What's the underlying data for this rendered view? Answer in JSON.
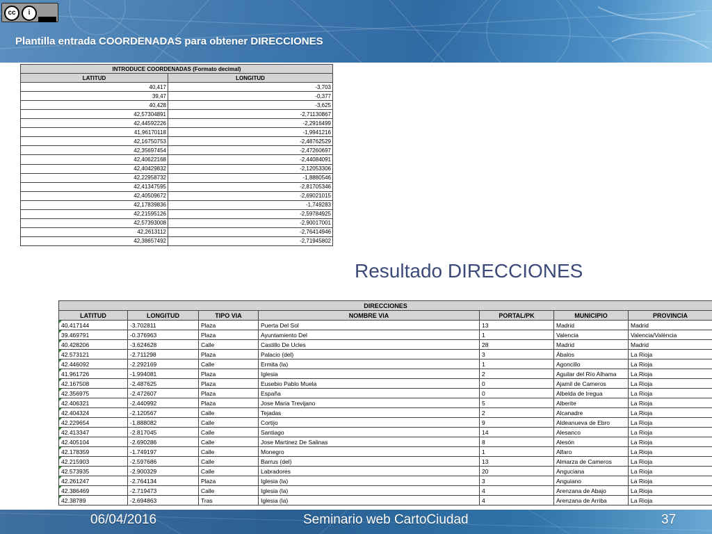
{
  "header": {
    "title": "Plantilla entrada COORDENADAS para obtener DIRECCIONES"
  },
  "coords_table": {
    "title": "INTRODUCE COORDENADAS (Formato decimal)",
    "columns": [
      "LATITUD",
      "LONGITUD"
    ],
    "rows": [
      [
        "40,417",
        "-3,703"
      ],
      [
        "39,47",
        "-0,377"
      ],
      [
        "40,428",
        "-3,625"
      ],
      [
        "42,57304891",
        "-2,71130867"
      ],
      [
        "42,44592226",
        "-2,2916499"
      ],
      [
        "41,96170118",
        "-1,9941216"
      ],
      [
        "42,16750753",
        "-2,48762529"
      ],
      [
        "42,35697454",
        "-2,47260697"
      ],
      [
        "42,40622168",
        "-2,44084091"
      ],
      [
        "42,40429832",
        "-2,12053306"
      ],
      [
        "42,22958732",
        "-1,8880546"
      ],
      [
        "42,41347595",
        "-2,81705346"
      ],
      [
        "42,40509672",
        "-2,69021015"
      ],
      [
        "42,17839836",
        "-1,749283"
      ],
      [
        "42,21595126",
        "-2,59784925"
      ],
      [
        "42,57393008",
        "-2,90017001"
      ],
      [
        "42,2613112",
        "-2,76414946"
      ],
      [
        "42,38657492",
        "-2,71945802"
      ]
    ]
  },
  "result_heading": "Resultado DIRECCIONES",
  "dir_table": {
    "title": "DIRECCIONES",
    "columns": [
      "LATITUD",
      "LONGITUD",
      "TIPO VIA",
      "NOMBRE VIA",
      "PORTAL/PK",
      "MUNICIPIO",
      "PROVINCIA"
    ],
    "rows": [
      [
        "40.417144",
        "-3.702811",
        "Plaza",
        "Puerta Del Sol",
        "13",
        "Madrid",
        "Madrid"
      ],
      [
        "39.469791",
        "-0.376963",
        "Plaza",
        "Ayuntamiento Del",
        "1",
        "Valencia",
        "Valencia/València"
      ],
      [
        "40.428206",
        "-3.624628",
        "Calle",
        "Castillo De Ucles",
        "28",
        "Madrid",
        "Madrid"
      ],
      [
        "42.573121",
        "-2.711298",
        "Plaza",
        "Palacio (del)",
        "3",
        "Ábalos",
        "La Rioja"
      ],
      [
        "42.446092",
        "-2.292169",
        "Calle",
        "Ermita (la)",
        "1",
        "Agoncillo",
        "La Rioja"
      ],
      [
        "41.961726",
        "-1.994081",
        "Plaza",
        "Iglesia",
        "2",
        "Aguilar del Río Alhama",
        "La Rioja"
      ],
      [
        "42.167508",
        "-2.487625",
        "Plaza",
        "Eusebio Pablo Muela",
        "0",
        "Ajamil de Cameros",
        "La Rioja"
      ],
      [
        "42.356975",
        "-2.472607",
        "Plaza",
        "España",
        "0",
        "Albelda de Iregua",
        "La Rioja"
      ],
      [
        "42.406321",
        "-2.440992",
        "Plaza",
        "Jose Maria Trevijano",
        "5",
        "Alberite",
        "La Rioja"
      ],
      [
        "42.404324",
        "-2.120567",
        "Calle",
        "Tejadas",
        "2",
        "Alcanadre",
        "La Rioja"
      ],
      [
        "42.229654",
        "-1.888082",
        "Calle",
        "Cortijo",
        "9",
        "Aldeanueva de Ebro",
        "La Rioja"
      ],
      [
        "42.413347",
        "-2.817045",
        "Calle",
        "Santiago",
        "14",
        "Alesanco",
        "La Rioja"
      ],
      [
        "42.405104",
        "-2.690286",
        "Calle",
        "Jose Martinez De Salinas",
        "8",
        "Alesón",
        "La Rioja"
      ],
      [
        "42.178359",
        "-1.749197",
        "Calle",
        "Monegro",
        "1",
        "Alfaro",
        "La Rioja"
      ],
      [
        "42.215903",
        "-2.597686",
        "Calle",
        "Barrus (del)",
        "13",
        "Almarza de Cameros",
        "La Rioja"
      ],
      [
        "42.573935",
        "-2.900329",
        "Calle",
        "Labradores",
        "20",
        "Anguciana",
        "La Rioja"
      ],
      [
        "42.261247",
        "-2.764134",
        "Plaza",
        "Iglesia (la)",
        "3",
        "Anguiano",
        "La Rioja"
      ],
      [
        "42.386469",
        "-2.719473",
        "Calle",
        "Iglesia (la)",
        "4",
        "Arenzana de Abajo",
        "La Rioja"
      ],
      [
        "42.38789",
        "-2.694863",
        "Tras",
        "Iglesia (la)",
        "4",
        "Arenzana de Arriba",
        "La Rioja"
      ]
    ]
  },
  "footer": {
    "date": "06/04/2016",
    "center": "Seminario web CartoCiudad",
    "page": "37"
  },
  "license": {
    "icons": [
      "cc-icon",
      "person-icon"
    ]
  },
  "colors": {
    "heading": "#3b4a78",
    "header_bg": "#3f78ad",
    "marker": "#2e8b2e"
  }
}
